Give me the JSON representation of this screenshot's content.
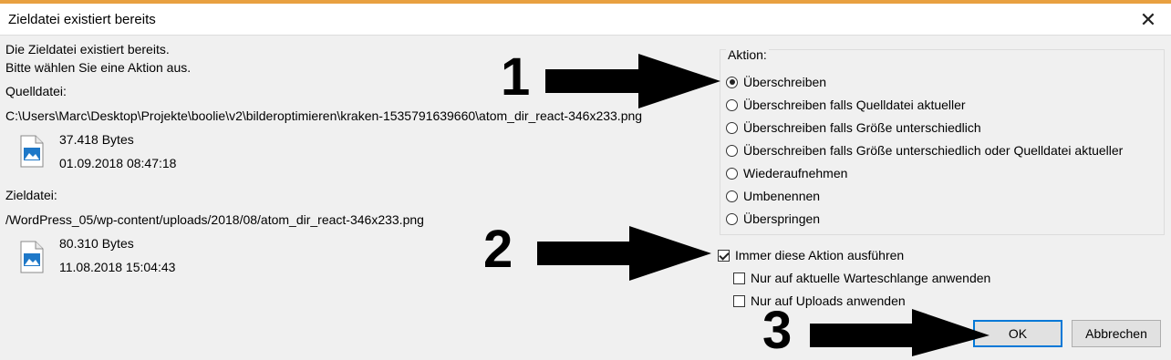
{
  "window": {
    "title": "Zieldatei existiert bereits",
    "close_glyph": "✕"
  },
  "info": {
    "line1": "Die Zieldatei existiert bereits.",
    "line2": "Bitte wählen Sie eine Aktion aus."
  },
  "source": {
    "label": "Quelldatei:",
    "path": "C:\\Users\\Marc\\Desktop\\Projekte\\boolie\\v2\\bilderoptimieren\\kraken-1535791639660\\atom_dir_react-346x233.png",
    "size": "37.418 Bytes",
    "date": "01.09.2018 08:47:18",
    "icon": "image-file-icon"
  },
  "target": {
    "label": "Zieldatei:",
    "path": "/WordPress_05/wp-content/uploads/2018/08/atom_dir_react-346x233.png",
    "size": "80.310 Bytes",
    "date": "11.08.2018 15:04:43",
    "icon": "image-file-icon"
  },
  "action": {
    "legend": "Aktion:",
    "options": [
      {
        "label": "Überschreiben",
        "checked": true
      },
      {
        "label": "Überschreiben falls Quelldatei aktueller",
        "checked": false
      },
      {
        "label": "Überschreiben falls Größe unterschiedlich",
        "checked": false
      },
      {
        "label": "Überschreiben falls Größe unterschiedlich oder Quelldatei aktueller",
        "checked": false
      },
      {
        "label": "Wiederaufnehmen",
        "checked": false
      },
      {
        "label": "Umbenennen",
        "checked": false
      },
      {
        "label": "Überspringen",
        "checked": false
      }
    ]
  },
  "checkboxes": {
    "always": {
      "label": "Immer diese Aktion ausführen",
      "checked": true
    },
    "queue": {
      "label": "Nur auf aktuelle Warteschlange anwenden",
      "checked": false
    },
    "uploads": {
      "label": "Nur auf Uploads anwenden",
      "checked": false
    }
  },
  "buttons": {
    "ok": "OK",
    "cancel": "Abbrechen"
  },
  "annotations": {
    "n1": "1",
    "n2": "2",
    "n3": "3"
  },
  "colors": {
    "accent": "#0078d7",
    "dialog_bg": "#f0f0f0",
    "icon_blue": "#1e78c8"
  }
}
